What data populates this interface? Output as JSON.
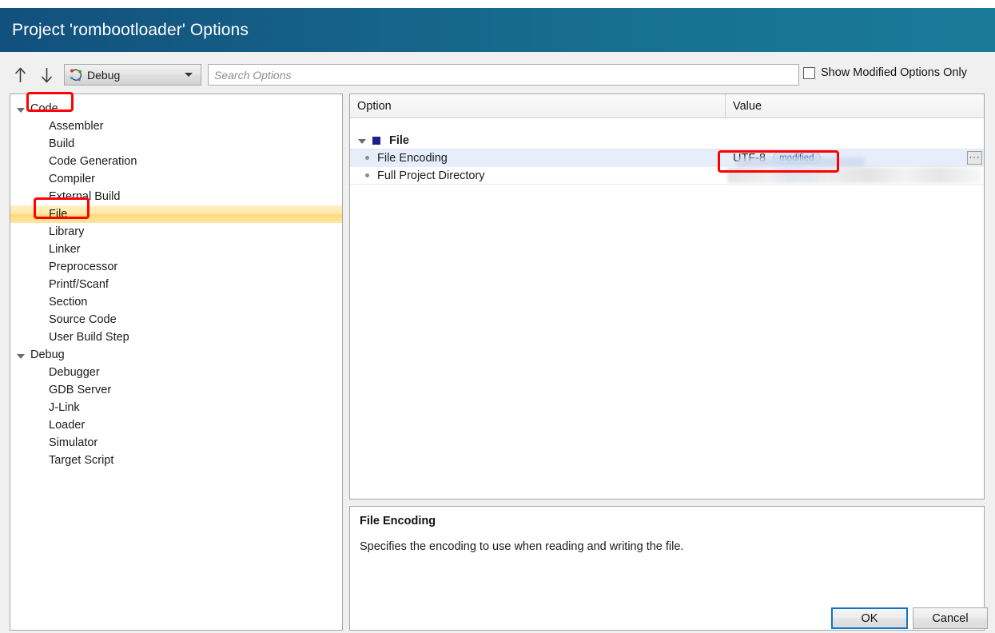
{
  "window": {
    "title": "Project 'rombootloader' Options"
  },
  "toolbar": {
    "move_up_icon": "arrow-up-icon",
    "move_down_icon": "arrow-down-icon",
    "config_combo": {
      "icon": "build-config-icon",
      "value": "Debug",
      "arrow_icon": "chevron-down-icon"
    },
    "search": {
      "value": "",
      "placeholder": "Search Options"
    },
    "show_modified_only": {
      "label": "Show Modified Options Only",
      "checked": false
    }
  },
  "tree": {
    "groups": [
      {
        "label": "Code",
        "expanded": true,
        "children": [
          "Assembler",
          "Build",
          "Code Generation",
          "Compiler",
          "External Build",
          "File",
          "Library",
          "Linker",
          "Preprocessor",
          "Printf/Scanf",
          "Section",
          "Source Code",
          "User Build Step"
        ],
        "selected_child": "File"
      },
      {
        "label": "Debug",
        "expanded": true,
        "children": [
          "Debugger",
          "GDB Server",
          "J-Link",
          "Loader",
          "Simulator",
          "Target Script"
        ],
        "selected_child": null
      }
    ]
  },
  "options_table": {
    "columns": [
      "Option",
      "Value"
    ],
    "groups": [
      {
        "name": "File",
        "expanded": true,
        "rows": [
          {
            "option": "File Encoding",
            "value": "UTF-8",
            "badge": "modified",
            "selected": true,
            "has_browse_button": true,
            "browse_label": "···",
            "redacted": false
          },
          {
            "option": "Full Project Directory",
            "value": "",
            "badge": null,
            "selected": false,
            "has_browse_button": false,
            "redacted": true
          }
        ]
      }
    ]
  },
  "description": {
    "title": "File Encoding",
    "text": "Specifies the encoding to use when reading and writing the file."
  },
  "footer": {
    "ok_label": "OK",
    "cancel_label": "Cancel"
  },
  "annotations": {
    "color": "#ff0000",
    "boxes": [
      "code-tree-item",
      "file-tree-item",
      "file-encoding-value"
    ]
  },
  "colors": {
    "title_gradient_start": "#12507d",
    "title_gradient_end": "#1a7b99",
    "selection_tree": "#ffd97a",
    "selection_row": "#e7eefb",
    "badge_bg": "#d6e4f7",
    "focus_border": "#1175c4"
  }
}
